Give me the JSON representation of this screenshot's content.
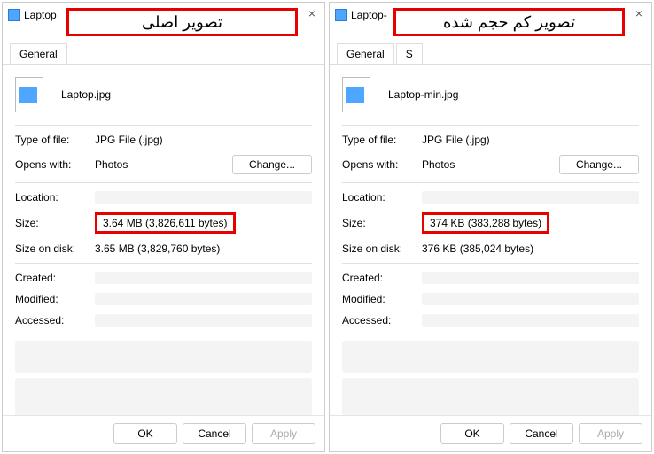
{
  "left": {
    "window_title_prefix": "Laptop",
    "red_label": "تصویر اصلی",
    "tab_general": "General",
    "filename": "Laptop.jpg",
    "type_label": "Type of file:",
    "type_value": "JPG File (.jpg)",
    "opens_label": "Opens with:",
    "opens_value": "Photos",
    "change_btn": "Change...",
    "location_label": "Location:",
    "size_label": "Size:",
    "size_value": "3.64 MB (3,826,611 bytes)",
    "disk_label": "Size on disk:",
    "disk_value": "3.65 MB (3,829,760 bytes)",
    "created_label": "Created:",
    "modified_label": "Modified:",
    "accessed_label": "Accessed:",
    "ok": "OK",
    "cancel": "Cancel",
    "apply": "Apply"
  },
  "right": {
    "window_title_prefix": "Laptop-",
    "red_label": "تصویر کم حجم شده",
    "tab_general": "General",
    "tab_s": "S",
    "filename": "Laptop-min.jpg",
    "type_label": "Type of file:",
    "type_value": "JPG File (.jpg)",
    "opens_label": "Opens with:",
    "opens_value": "Photos",
    "change_btn": "Change...",
    "location_label": "Location:",
    "size_label": "Size:",
    "size_value": "374 KB (383,288 bytes)",
    "disk_label": "Size on disk:",
    "disk_value": "376 KB (385,024 bytes)",
    "created_label": "Created:",
    "modified_label": "Modified:",
    "accessed_label": "Accessed:",
    "ok": "OK",
    "cancel": "Cancel",
    "apply": "Apply"
  }
}
